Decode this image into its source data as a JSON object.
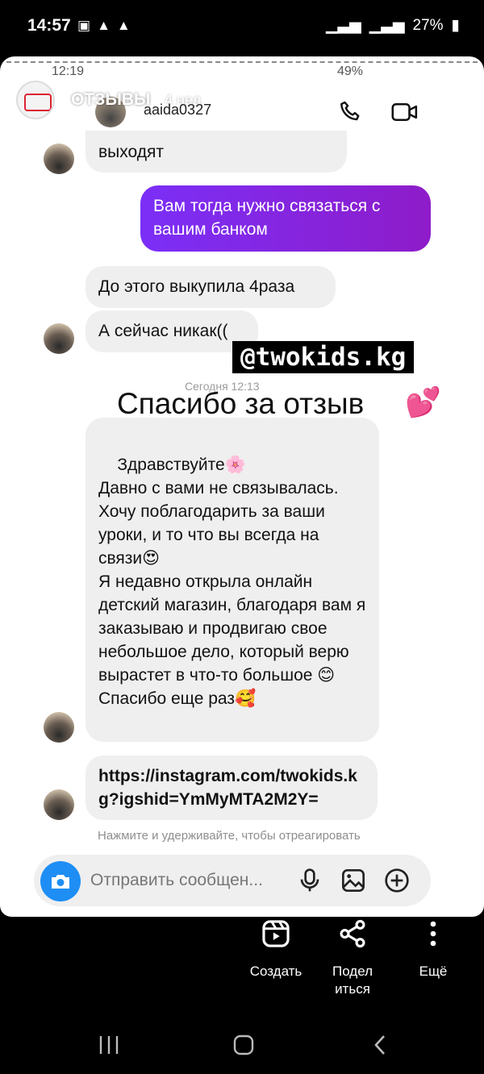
{
  "status_bar": {
    "time": "14:57",
    "battery": "27%"
  },
  "inner_status": {
    "time": "12:19",
    "battery": "49%"
  },
  "story": {
    "name": "ОТЗЫВЫ",
    "age": "4 нед."
  },
  "dm_header": {
    "username": "aaida0327"
  },
  "messages": {
    "m1": "выходят",
    "m2": "Вам тогда нужно связаться с вашим банком",
    "m3": "До этого выкупила 4раза",
    "m4": "А сейчас никак((",
    "m5": "Здравствуйте🌸\nДавно с вами не связывалась. Хочу поблагодарить за ваши уроки, и то что вы всегда на связи😍\nЯ недавно открыла онлайн детский магазин, благодаря вам я заказываю и продвигаю свое небольшое дело, который верю вырастет в что-то большое 😊\nСпасибо еще раз🥰",
    "m6": "https://instagram.com/twokids.kg?igshid=YmMyMTA2M2Y="
  },
  "date_stamp": "Сегодня 12:13",
  "sticker": {
    "tag": "@twokids.kg",
    "thanks": "Спасибо за отзыв",
    "heart": "💕"
  },
  "hint": "Нажмите и удерживайте, чтобы отреагировать",
  "composer": {
    "placeholder": "Отправить сообщен..."
  },
  "actions": {
    "create": "Создать",
    "share": "Подел\nиться",
    "more": "Ещё"
  },
  "colors": {
    "outgoing": "#8a1fd6",
    "incoming": "#efefef",
    "camera": "#1e8ef5"
  },
  "icons": [
    "phone-icon",
    "video-icon",
    "camera-icon",
    "mic-icon",
    "image-icon",
    "plus-icon",
    "reels-icon",
    "share-icon",
    "more-icon"
  ]
}
